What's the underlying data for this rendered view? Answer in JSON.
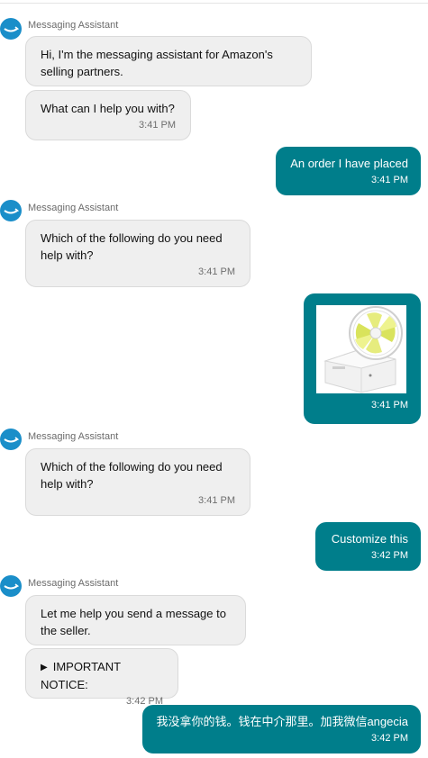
{
  "sender_name": "Messaging Assistant",
  "messages": [
    {
      "text": "Hi, I'm the messaging assistant for Amazon's selling partners."
    },
    {
      "text": "What can I help you with?",
      "time": "3:41 PM"
    },
    {
      "text": "An order I have placed",
      "time": "3:41 PM"
    },
    {
      "text": "Which of the following do you need help with?",
      "time": "3:41 PM"
    },
    {
      "image_icon": "usb-desk-fan-product-image",
      "time": "3:41 PM"
    },
    {
      "text": "Which of the following do you need help with?",
      "time": "3:41 PM"
    },
    {
      "text": "Customize this",
      "time": "3:42 PM"
    },
    {
      "text": "Let me help you send a message to the seller.",
      "time": ""
    },
    {
      "text": "IMPORTANT NOTICE:",
      "time": "3:42 PM"
    },
    {
      "text": "我没拿你的钱。钱在中介那里。加我微信angecia",
      "time": "3:42 PM"
    }
  ],
  "colors": {
    "outgoing_bubble": "#007e8b",
    "incoming_bubble": "#efefef",
    "avatar": "#1a8ec9"
  }
}
